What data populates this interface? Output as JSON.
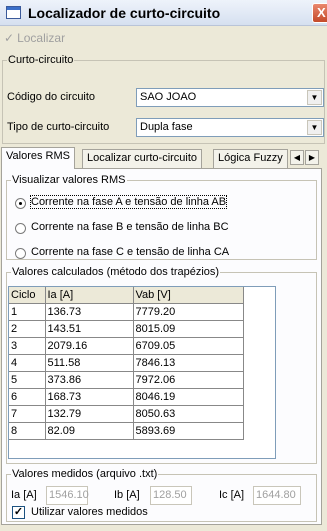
{
  "window": {
    "title": "Localizador de curto-circuito",
    "close_glyph": "X"
  },
  "toolbar": {
    "localizar_label": "Localizar",
    "localizar_icon": "check-icon"
  },
  "curto": {
    "legend": "Curto-circuito",
    "codigo_label": "Código do circuito",
    "codigo_value": "SAO JOAO",
    "tipo_label": "Tipo de curto-circuito",
    "tipo_value": "Dupla fase"
  },
  "tabs": [
    {
      "label": "Valores RMS",
      "active": true
    },
    {
      "label": "Localizar curto-circuito",
      "active": false
    },
    {
      "label": "Lógica Fuzzy",
      "active": false
    }
  ],
  "visualizar": {
    "legend": "Visualizar valores RMS",
    "options": [
      {
        "label": "Corrente na fase A e tensão de linha AB",
        "selected": true
      },
      {
        "label": "Corrente na fase B e tensão de linha BC",
        "selected": false
      },
      {
        "label": "Corrente na fase C e tensão de linha CA",
        "selected": false
      }
    ]
  },
  "calculados": {
    "legend": "Valores calculados (método dos trapézios)",
    "columns": [
      "Ciclo",
      "Ia [A]",
      "Vab [V]"
    ],
    "rows": [
      [
        "1",
        "136.73",
        "7779.20"
      ],
      [
        "2",
        "143.51",
        "8015.09"
      ],
      [
        "3",
        "2079.16",
        "6709.05"
      ],
      [
        "4",
        "511.58",
        "7846.13"
      ],
      [
        "5",
        "373.86",
        "7972.06"
      ],
      [
        "6",
        "168.73",
        "8046.19"
      ],
      [
        "7",
        "132.79",
        "8050.63"
      ],
      [
        "8",
        "82.09",
        "5893.69"
      ]
    ]
  },
  "medidos": {
    "legend": "Valores medidos (arquivo .txt)",
    "ia_label": "Ia [A]",
    "ia_value": "1546.10",
    "ib_label": "Ib [A]",
    "ib_value": "128.50",
    "ic_label": "Ic [A]",
    "ic_value": "1644.80",
    "usar_label": "Utilizar valores medidos",
    "usar_checked": true
  }
}
